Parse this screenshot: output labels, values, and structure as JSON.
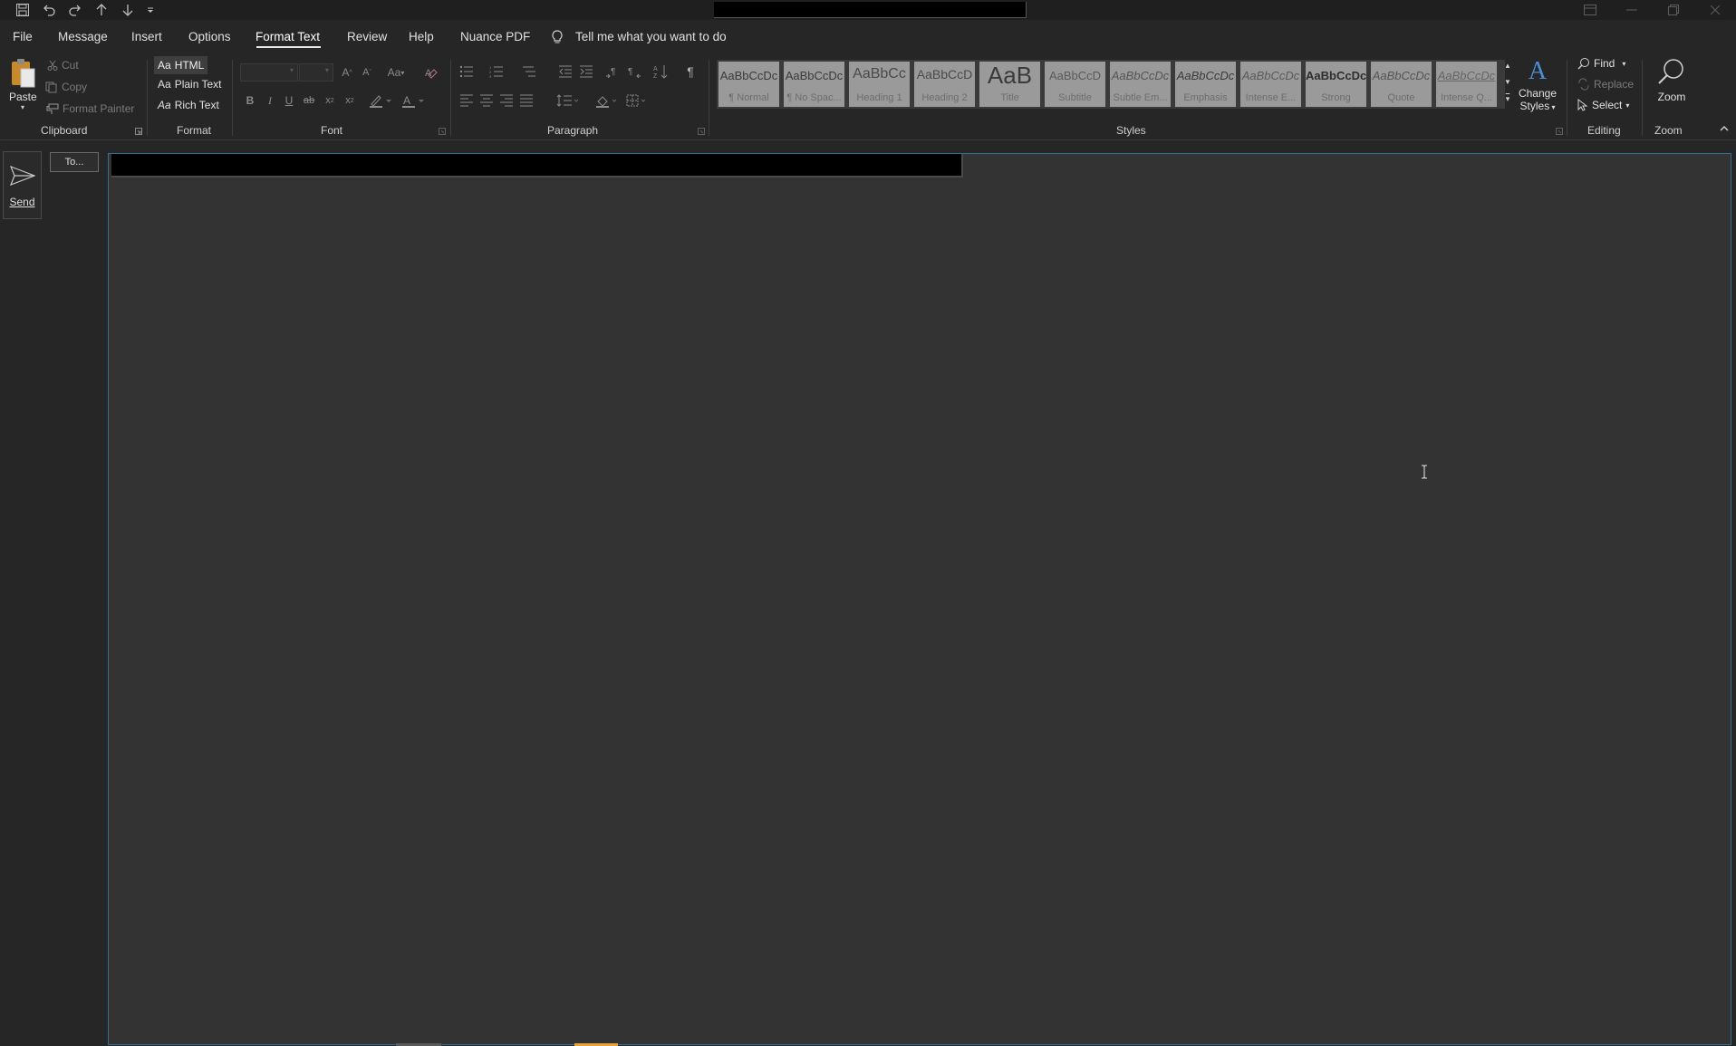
{
  "titlebar": {
    "quick_access": [
      "save-icon",
      "undo-icon",
      "redo-icon",
      "up-arrow-icon",
      "down-arrow-icon",
      "customize-icon"
    ],
    "window_buttons": [
      "ribbon-display-icon",
      "minimize-icon",
      "restore-icon",
      "close-icon"
    ]
  },
  "tabs": [
    {
      "label": "File"
    },
    {
      "label": "Message"
    },
    {
      "label": "Insert"
    },
    {
      "label": "Options"
    },
    {
      "label": "Format Text",
      "active": true
    },
    {
      "label": "Review"
    },
    {
      "label": "Help"
    },
    {
      "label": "Nuance PDF"
    }
  ],
  "tell_me": "Tell me what you want to do",
  "clipboard": {
    "paste": "Paste",
    "cut": "Cut",
    "copy": "Copy",
    "format_painter": "Format Painter",
    "group": "Clipboard"
  },
  "format": {
    "html": "HTML",
    "plain": "Plain Text",
    "rich": "Rich Text",
    "prefix": "Aa",
    "group": "Format"
  },
  "font": {
    "group": "Font",
    "change_case": "Aa",
    "bold": "B",
    "italic": "I",
    "underline": "U",
    "strike": "ab",
    "sub": "x",
    "sup": "x"
  },
  "paragraph": {
    "group": "Paragraph"
  },
  "styles": {
    "group": "Styles",
    "items": [
      {
        "preview": "AaBbCcDc",
        "name": "¶ Normal"
      },
      {
        "preview": "AaBbCcDc",
        "name": "¶ No Spac..."
      },
      {
        "preview": "AaBbCc",
        "name": "Heading 1"
      },
      {
        "preview": "AaBbCcD",
        "name": "Heading 2"
      },
      {
        "preview": "AaB",
        "name": "Title"
      },
      {
        "preview": "AaBbCcD",
        "name": "Subtitle"
      },
      {
        "preview": "AaBbCcDc",
        "name": "Subtle Em..."
      },
      {
        "preview": "AaBbCcDc",
        "name": "Emphasis"
      },
      {
        "preview": "AaBbCcDc",
        "name": "Intense E..."
      },
      {
        "preview": "AaBbCcDc",
        "name": "Strong"
      },
      {
        "preview": "AaBbCcDc",
        "name": "Quote"
      },
      {
        "preview": "AaBbCcDc",
        "name": "Intense Q..."
      }
    ],
    "change_styles_1": "Change",
    "change_styles_2": "Styles"
  },
  "editing": {
    "find": "Find",
    "replace": "Replace",
    "select": "Select",
    "group": "Editing"
  },
  "zoom": {
    "label": "Zoom",
    "group": "Zoom"
  },
  "compose": {
    "send": "Send",
    "to": "To..."
  },
  "colors": {
    "accent_blue": "#2f6f8f",
    "style_gallery": "#9a9a9a",
    "paste_orange": "#e8a23a"
  }
}
